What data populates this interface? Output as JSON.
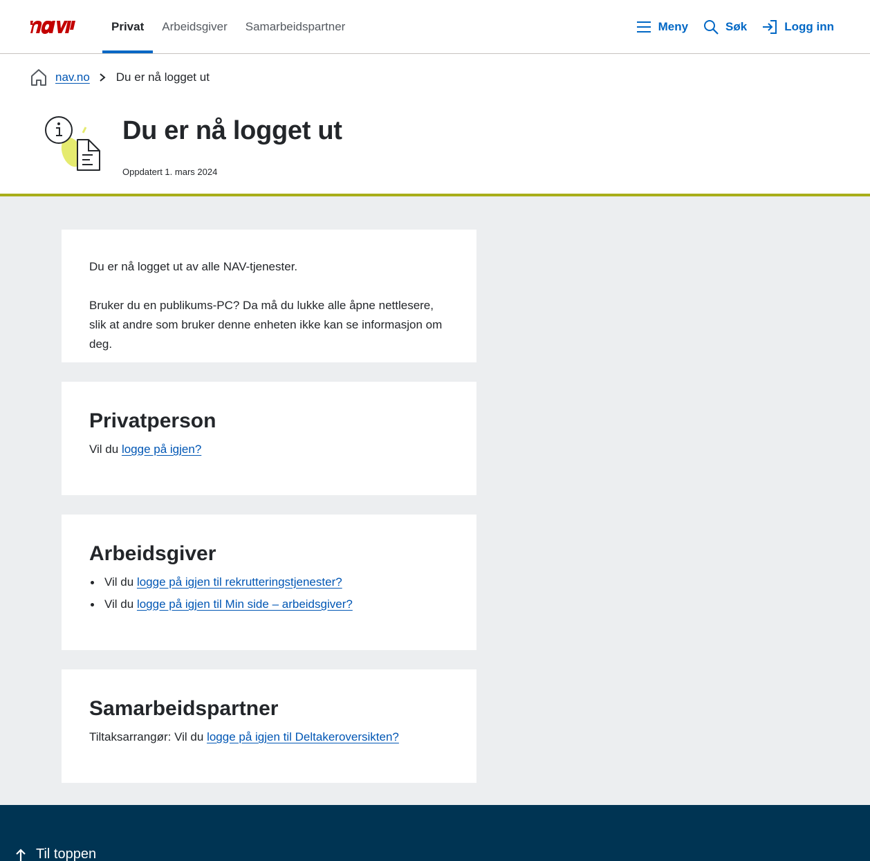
{
  "header": {
    "logo_text": "nav",
    "tabs": [
      {
        "label": "Privat",
        "active": true
      },
      {
        "label": "Arbeidsgiver",
        "active": false
      },
      {
        "label": "Samarbeidspartner",
        "active": false
      }
    ],
    "menu_label": "Meny",
    "search_label": "Søk",
    "login_label": "Logg inn"
  },
  "breadcrumb": {
    "home_label": "nav.no",
    "current": "Du er nå logget ut"
  },
  "page": {
    "title": "Du er nå logget ut",
    "updated": "Oppdatert 1. mars 2024"
  },
  "intro": {
    "p1": "Du er nå logget ut av alle NAV-tjenester.",
    "p2": "Bruker du en publikums-PC? Da må du lukke alle åpne nettlesere, slik at andre som bruker denne enheten ikke kan se informasjon om deg."
  },
  "privatperson": {
    "heading": "Privatperson",
    "prefix": "Vil du ",
    "link": "logge på igjen?"
  },
  "arbeidsgiver": {
    "heading": "Arbeidsgiver",
    "items": [
      {
        "prefix": "Vil du ",
        "link": "logge på igjen til rekrutteringstjenester?"
      },
      {
        "prefix": "Vil du ",
        "link": "logge på igjen til Min side – arbeidsgiver?"
      }
    ]
  },
  "samarbeidspartner": {
    "heading": "Samarbeidspartner",
    "prefix": "Tiltaksarrangør: Vil du ",
    "link": "logge på igjen til Deltakeroversikten?"
  },
  "footer": {
    "to_top": "Til toppen"
  },
  "colors": {
    "brand_red": "#c30000",
    "link_blue": "#0056b4",
    "accent_blue": "#0067c5",
    "divider_green": "#a8ae1a",
    "footer_bg": "#003453",
    "content_bg": "#eceef0"
  }
}
